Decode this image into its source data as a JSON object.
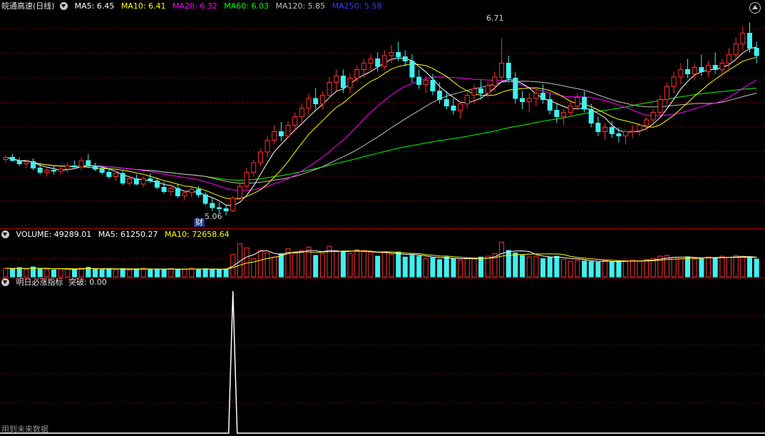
{
  "main": {
    "title": "皖通高速(日线)",
    "ma": [
      {
        "label": "MA5: 6.45",
        "color": "#ffffff"
      },
      {
        "label": "MA10: 6.41",
        "color": "#ffff00"
      },
      {
        "label": "MA20: 6.32",
        "color": "#ff00ff"
      },
      {
        "label": "MA60: 6.03",
        "color": "#00ff00"
      },
      {
        "label": "MA120: 5.85",
        "color": "#c0c0c0"
      },
      {
        "label": "MA250: 5.58",
        "color": "#3a3aff"
      }
    ],
    "high_label": "6.71",
    "low_label": "5.06",
    "event_tag": "财"
  },
  "volume": {
    "labels": [
      {
        "label": "VOLUME: 49289.01",
        "color": "#ffffff"
      },
      {
        "label": "MA5: 61250.27",
        "color": "#ffffff"
      },
      {
        "label": "MA10: 72658.64",
        "color": "#ffff00"
      }
    ]
  },
  "indicator": {
    "name": "明日必涨指标",
    "value": "突破: 0.00",
    "footer": "用到未来数据"
  },
  "colors": {
    "up": "#ff3030",
    "down": "#40f0f0",
    "grid": "#7a0000",
    "sep": "#b00000"
  },
  "chart_data": {
    "type": "candlestick",
    "price_range": [
      4.95,
      6.95
    ],
    "candles": [
      [
        5.58,
        5.62,
        5.55,
        5.6
      ],
      [
        5.6,
        5.63,
        5.56,
        5.57
      ],
      [
        5.57,
        5.6,
        5.52,
        5.54
      ],
      [
        5.54,
        5.58,
        5.5,
        5.56
      ],
      [
        5.56,
        5.59,
        5.48,
        5.5
      ],
      [
        5.5,
        5.55,
        5.44,
        5.46
      ],
      [
        5.46,
        5.5,
        5.42,
        5.48
      ],
      [
        5.48,
        5.52,
        5.44,
        5.47
      ],
      [
        5.47,
        5.51,
        5.44,
        5.49
      ],
      [
        5.49,
        5.55,
        5.46,
        5.52
      ],
      [
        5.52,
        5.57,
        5.5,
        5.51
      ],
      [
        5.51,
        5.6,
        5.48,
        5.57
      ],
      [
        5.57,
        5.63,
        5.5,
        5.52
      ],
      [
        5.52,
        5.55,
        5.47,
        5.49
      ],
      [
        5.49,
        5.52,
        5.44,
        5.46
      ],
      [
        5.46,
        5.5,
        5.4,
        5.42
      ],
      [
        5.42,
        5.47,
        5.38,
        5.45
      ],
      [
        5.45,
        5.48,
        5.34,
        5.36
      ],
      [
        5.36,
        5.42,
        5.33,
        5.4
      ],
      [
        5.4,
        5.44,
        5.34,
        5.35
      ],
      [
        5.35,
        5.42,
        5.32,
        5.4
      ],
      [
        5.4,
        5.45,
        5.36,
        5.38
      ],
      [
        5.38,
        5.41,
        5.3,
        5.32
      ],
      [
        5.32,
        5.37,
        5.26,
        5.28
      ],
      [
        5.28,
        5.34,
        5.24,
        5.31
      ],
      [
        5.31,
        5.35,
        5.22,
        5.24
      ],
      [
        5.24,
        5.29,
        5.2,
        5.27
      ],
      [
        5.27,
        5.32,
        5.23,
        5.3
      ],
      [
        5.3,
        5.33,
        5.22,
        5.25
      ],
      [
        5.25,
        5.28,
        5.15,
        5.17
      ],
      [
        5.17,
        5.22,
        5.1,
        5.13
      ],
      [
        5.13,
        5.18,
        5.08,
        5.12
      ],
      [
        5.12,
        5.15,
        5.06,
        5.1
      ],
      [
        5.1,
        5.24,
        5.09,
        5.22
      ],
      [
        5.22,
        5.36,
        5.2,
        5.33
      ],
      [
        5.33,
        5.5,
        5.3,
        5.46
      ],
      [
        5.46,
        5.58,
        5.42,
        5.55
      ],
      [
        5.55,
        5.68,
        5.52,
        5.65
      ],
      [
        5.65,
        5.8,
        5.6,
        5.76
      ],
      [
        5.76,
        5.9,
        5.72,
        5.84
      ],
      [
        5.84,
        5.93,
        5.75,
        5.8
      ],
      [
        5.8,
        5.94,
        5.78,
        5.9
      ],
      [
        5.9,
        6.02,
        5.84,
        5.98
      ],
      [
        5.98,
        6.1,
        5.9,
        6.06
      ],
      [
        6.06,
        6.2,
        6.0,
        6.15
      ],
      [
        6.15,
        6.25,
        6.05,
        6.1
      ],
      [
        6.1,
        6.22,
        6.05,
        6.18
      ],
      [
        6.18,
        6.35,
        6.15,
        6.3
      ],
      [
        6.3,
        6.42,
        6.22,
        6.36
      ],
      [
        6.36,
        6.42,
        6.2,
        6.25
      ],
      [
        6.25,
        6.38,
        6.2,
        6.34
      ],
      [
        6.34,
        6.46,
        6.3,
        6.42
      ],
      [
        6.42,
        6.52,
        6.35,
        6.48
      ],
      [
        6.48,
        6.56,
        6.4,
        6.52
      ],
      [
        6.52,
        6.58,
        6.4,
        6.45
      ],
      [
        6.45,
        6.6,
        6.42,
        6.55
      ],
      [
        6.55,
        6.65,
        6.48,
        6.58
      ],
      [
        6.58,
        6.68,
        6.5,
        6.54
      ],
      [
        6.54,
        6.6,
        6.45,
        6.5
      ],
      [
        6.5,
        6.56,
        6.3,
        6.35
      ],
      [
        6.35,
        6.42,
        6.24,
        6.28
      ],
      [
        6.28,
        6.36,
        6.2,
        6.32
      ],
      [
        6.32,
        6.38,
        6.18,
        6.22
      ],
      [
        6.22,
        6.3,
        6.1,
        6.14
      ],
      [
        6.14,
        6.22,
        6.05,
        6.08
      ],
      [
        6.08,
        6.15,
        6.0,
        6.04
      ],
      [
        6.04,
        6.12,
        5.96,
        6.1
      ],
      [
        6.1,
        6.2,
        6.06,
        6.18
      ],
      [
        6.18,
        6.28,
        6.1,
        6.24
      ],
      [
        6.24,
        6.32,
        6.14,
        6.2
      ],
      [
        6.2,
        6.3,
        6.16,
        6.27
      ],
      [
        6.27,
        6.4,
        6.22,
        6.35
      ],
      [
        6.35,
        6.71,
        6.3,
        6.48
      ],
      [
        6.48,
        6.55,
        6.3,
        6.34
      ],
      [
        6.34,
        6.4,
        6.1,
        6.15
      ],
      [
        6.15,
        6.22,
        6.05,
        6.12
      ],
      [
        6.12,
        6.2,
        6.02,
        6.15
      ],
      [
        6.15,
        6.24,
        6.08,
        6.2
      ],
      [
        6.2,
        6.28,
        6.1,
        6.14
      ],
      [
        6.14,
        6.2,
        6.0,
        6.04
      ],
      [
        6.04,
        6.1,
        5.92,
        5.98
      ],
      [
        5.98,
        6.05,
        5.9,
        6.02
      ],
      [
        6.02,
        6.12,
        5.98,
        6.08
      ],
      [
        6.08,
        6.2,
        6.04,
        6.16
      ],
      [
        6.16,
        6.22,
        6.02,
        6.05
      ],
      [
        6.05,
        6.1,
        5.88,
        5.92
      ],
      [
        5.92,
        5.98,
        5.8,
        5.84
      ],
      [
        5.84,
        5.92,
        5.76,
        5.88
      ],
      [
        5.88,
        5.94,
        5.78,
        5.82
      ],
      [
        5.82,
        5.88,
        5.74,
        5.8
      ],
      [
        5.8,
        5.86,
        5.72,
        5.84
      ],
      [
        5.84,
        5.9,
        5.78,
        5.85
      ],
      [
        5.85,
        5.92,
        5.8,
        5.9
      ],
      [
        5.9,
        5.98,
        5.85,
        5.95
      ],
      [
        5.95,
        6.05,
        5.9,
        6.02
      ],
      [
        6.02,
        6.18,
        5.98,
        6.14
      ],
      [
        6.14,
        6.3,
        6.1,
        6.26
      ],
      [
        6.26,
        6.4,
        6.2,
        6.35
      ],
      [
        6.35,
        6.48,
        6.28,
        6.42
      ],
      [
        6.42,
        6.52,
        6.34,
        6.38
      ],
      [
        6.38,
        6.48,
        6.32,
        6.44
      ],
      [
        6.44,
        6.56,
        6.36,
        6.4
      ],
      [
        6.4,
        6.5,
        6.35,
        6.46
      ],
      [
        6.46,
        6.58,
        6.38,
        6.42
      ],
      [
        6.42,
        6.52,
        6.36,
        6.48
      ],
      [
        6.48,
        6.62,
        6.4,
        6.56
      ],
      [
        6.56,
        6.72,
        6.5,
        6.66
      ],
      [
        6.66,
        6.82,
        6.6,
        6.76
      ],
      [
        6.76,
        6.86,
        6.58,
        6.62
      ],
      [
        6.62,
        6.68,
        6.48,
        6.55
      ]
    ],
    "volume_range": [
      0,
      220000
    ],
    "volume": [
      52000,
      48000,
      56000,
      44000,
      60000,
      50000,
      46000,
      42000,
      50000,
      48000,
      45000,
      52000,
      58000,
      47000,
      43000,
      49000,
      44000,
      50000,
      42000,
      47000,
      52000,
      46000,
      48000,
      44000,
      50000,
      45000,
      47000,
      52000,
      43000,
      49000,
      46000,
      44000,
      48000,
      135000,
      200000,
      175000,
      110000,
      160000,
      145000,
      120000,
      140000,
      170000,
      150000,
      160000,
      180000,
      130000,
      140000,
      185000,
      155000,
      150000,
      140000,
      165000,
      160000,
      150000,
      125000,
      145000,
      135000,
      150000,
      120000,
      130000,
      125000,
      110000,
      115000,
      105000,
      120000,
      110000,
      100000,
      115000,
      108000,
      120000,
      125000,
      140000,
      210000,
      160000,
      145000,
      130000,
      120000,
      125000,
      110000,
      118000,
      125000,
      105000,
      95000,
      100000,
      96000,
      92000,
      88000,
      98000,
      90000,
      95000,
      98000,
      100000,
      95000,
      105000,
      112000,
      125000,
      130000,
      118000,
      110000,
      120000,
      108000,
      115000,
      120000,
      112000,
      125000,
      118000,
      130000,
      125000,
      115000,
      108000
    ],
    "indicator_range": [
      0,
      1
    ],
    "indicator_spike_index": 33,
    "indicator_values_note": "0 everywhere except 1 at spike"
  }
}
